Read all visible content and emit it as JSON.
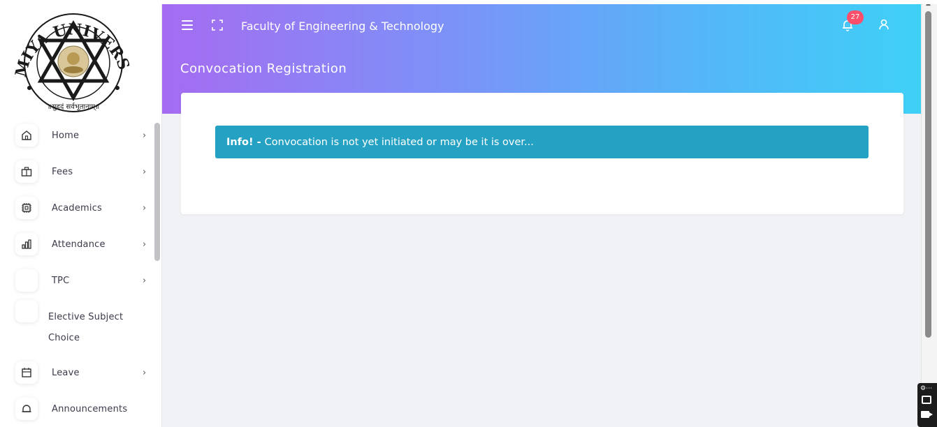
{
  "header": {
    "faculty_title": "Faculty of Engineering & Technology",
    "page_title": "Convocation Registration",
    "notification_count": "27"
  },
  "sidebar": {
    "logo_text_top": "ATMIYA UNIVERSITY",
    "logo_text_bottom": "॥सुहृदं सर्वभूतानाम्॥",
    "items": [
      {
        "label": "Home",
        "icon": "home-icon",
        "has_chevron": true
      },
      {
        "label": "Fees",
        "icon": "briefcase-icon",
        "has_chevron": true
      },
      {
        "label": "Academics",
        "icon": "chip-icon",
        "has_chevron": true
      },
      {
        "label": "Attendance",
        "icon": "bar-chart-icon",
        "has_chevron": true
      },
      {
        "label": "TPC",
        "icon": "",
        "has_chevron": true
      },
      {
        "label": "Elective Subject Choice",
        "icon": "",
        "has_chevron": false
      },
      {
        "label": "Leave",
        "icon": "calendar-icon",
        "has_chevron": true
      },
      {
        "label": "Announcements",
        "icon": "bell-icon",
        "has_chevron": false
      }
    ],
    "chevron": "›"
  },
  "alert": {
    "prefix": "Info! -",
    "message": "Convocation is not yet initiated or may be it is over..."
  },
  "colors": {
    "gradient_start": "#a56cf1",
    "gradient_end": "#3fd0f7",
    "alert_bg": "#25a2c3",
    "badge_bg": "#ff4f6a"
  }
}
